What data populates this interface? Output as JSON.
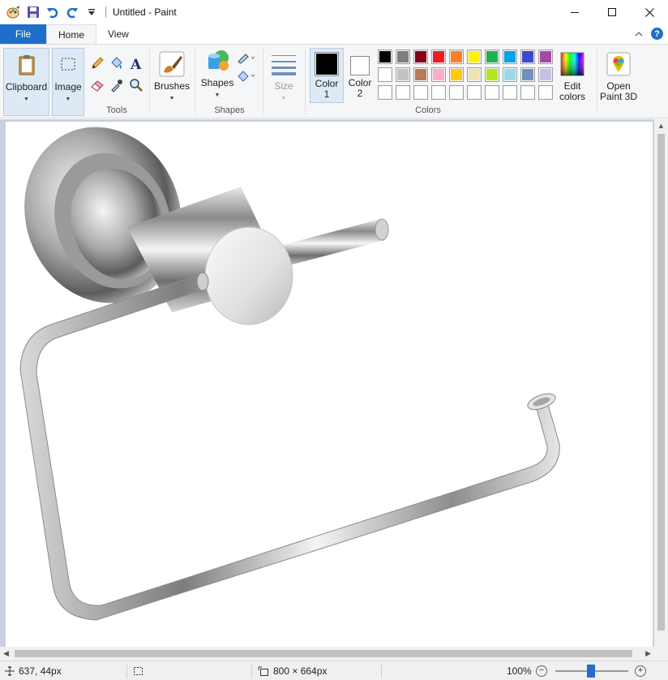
{
  "window": {
    "title": "Untitled - Paint"
  },
  "tabs": {
    "file": "File",
    "home": "Home",
    "view": "View"
  },
  "ribbon": {
    "clipboard": "Clipboard",
    "image": "Image",
    "tools_group": "Tools",
    "brushes": "Brushes",
    "shapes": "Shapes",
    "shapes_group": "Shapes",
    "size": "Size",
    "color1_line1": "Color",
    "color1_line2": "1",
    "color2_line1": "Color",
    "color2_line2": "2",
    "colors_group": "Colors",
    "edit_colors_line1": "Edit",
    "edit_colors_line2": "colors",
    "open3d_line1": "Open",
    "open3d_line2": "Paint 3D"
  },
  "palette": {
    "row1": [
      "#000000",
      "#7f7f7f",
      "#880015",
      "#ed1c24",
      "#ff7f27",
      "#fff200",
      "#22b14c",
      "#00a2e8",
      "#3f48cc",
      "#a349a4"
    ],
    "row2": [
      "#ffffff",
      "#c3c3c3",
      "#b97a57",
      "#ffaec9",
      "#ffc90e",
      "#efe4b0",
      "#b5e61d",
      "#99d9ea",
      "#7092be",
      "#c8bfe7"
    ],
    "row3": [
      "#ffffff",
      "#ffffff",
      "#ffffff",
      "#ffffff",
      "#ffffff",
      "#ffffff",
      "#ffffff",
      "#ffffff",
      "#ffffff",
      "#ffffff"
    ],
    "color1": "#000000",
    "color2": "#ffffff"
  },
  "status": {
    "cursor_pos": "637, 44px",
    "image_size": "800 × 664px",
    "zoom": "100%"
  }
}
